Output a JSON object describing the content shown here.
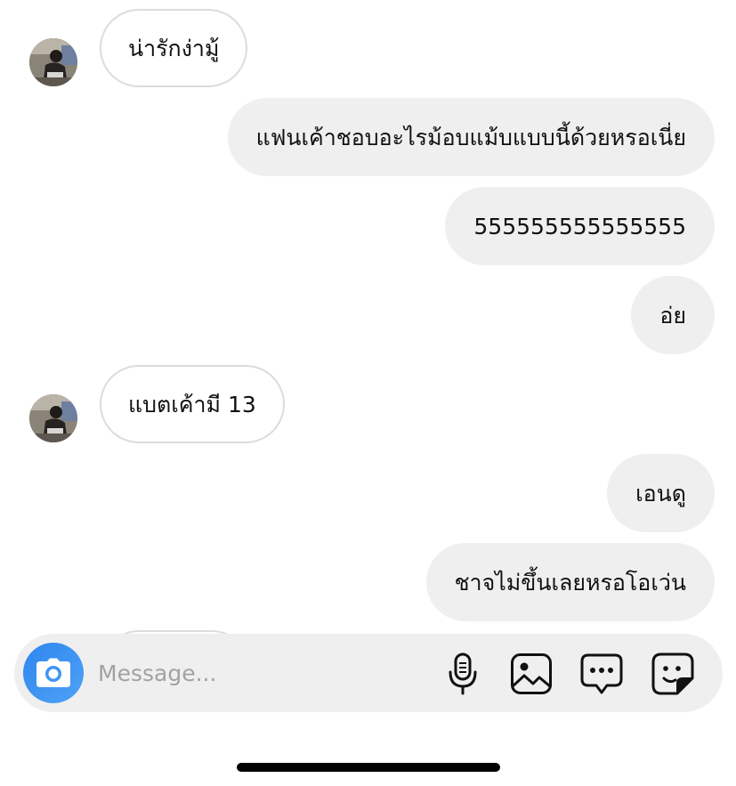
{
  "messages": [
    {
      "direction": "incoming",
      "text": "น่ารักง่ามู้",
      "has_avatar": true
    },
    {
      "direction": "outgoing",
      "text": "แฟนเค้าชอบอะไรม้อบแม้บแบบนี้ด้วยหรอเนี่ย"
    },
    {
      "direction": "outgoing",
      "text": "555555555555555"
    },
    {
      "direction": "outgoing",
      "text": "อ่ย"
    },
    {
      "direction": "incoming",
      "text": "แบตเค้ามี 13",
      "has_avatar": true
    },
    {
      "direction": "outgoing",
      "text": "เอนดู"
    },
    {
      "direction": "outgoing",
      "text": "ชาจไม่ขึ้นเลยหรอโอเว่น"
    }
  ],
  "composer": {
    "placeholder": "Message...",
    "value": "",
    "camera_icon": "camera-icon",
    "tools": [
      "microphone-icon",
      "gallery-icon",
      "chat-options-icon",
      "sticker-icon"
    ]
  },
  "colors": {
    "outgoing_bubble": "#efefef",
    "incoming_border": "#dcdcdc",
    "camera_button": "#3d95f2",
    "composer_bg": "#efefef",
    "placeholder": "#a2a2a2"
  }
}
